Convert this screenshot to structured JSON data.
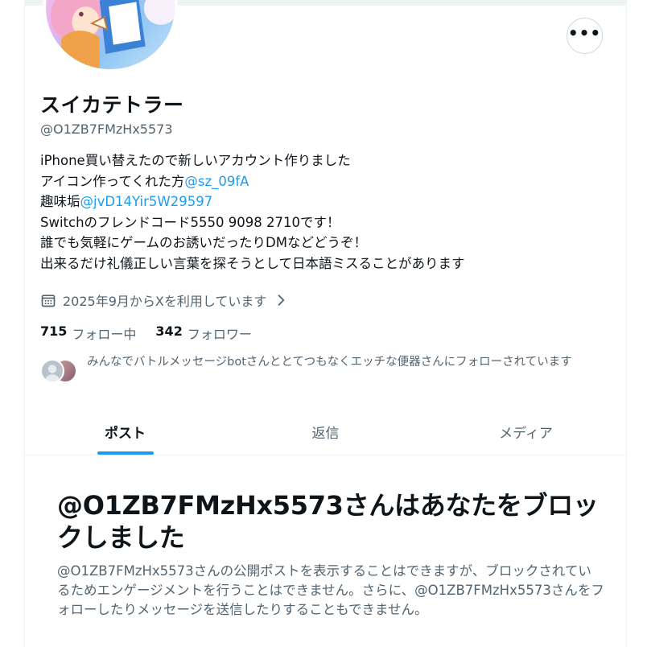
{
  "profile": {
    "display_name": "スイカテトラー",
    "handle": "@O1ZB7FMzHx5573",
    "bio": {
      "line1": "iPhone買い替えたので新しいアカウント作りました",
      "line2_text": "アイコン作ってくれた方",
      "line2_mention": "@sz_09fA",
      "line3_text": "趣味垢",
      "line3_mention": "@jvD14Yir5W29597",
      "line4": "Switchのフレンドコード5550 9098 2710です！",
      "line5": "誰でも気軽にゲームのお誘いだったりDMなどどうぞ！",
      "line6": "出来るだけ礼儀正しい言葉を探そうとして日本語ミスることがあります"
    },
    "joined": "2025年9月からXを利用しています",
    "following_count": "715",
    "following_label": "フォロー中",
    "followers_count": "342",
    "followers_label": "フォロワー",
    "followers_you_know": "みんなでバトルメッセージbotさんととてつもなくエッチな便器さんにフォローされています"
  },
  "tabs": [
    {
      "label": "ポスト",
      "active": true
    },
    {
      "label": "返信",
      "active": false
    },
    {
      "label": "メディア",
      "active": false
    }
  ],
  "blocked": {
    "title": "@O1ZB7FMzHx5573さんはあなたをブロックしました",
    "description": "@O1ZB7FMzHx5573さんの公開ポストを表示することはできますが、ブロックされているためエンゲージメントを行うことはできません。さらに、@O1ZB7FMzHx5573さんをフォローしたりメッセージを送信したりすることもできません。"
  },
  "icons": {
    "more": "more-horizontal-icon",
    "calendar": "calendar-icon",
    "chevron": "chevron-right-icon"
  },
  "colors": {
    "accent": "#1d9bf0",
    "text_primary": "#0f1419",
    "text_secondary": "#536471",
    "border": "#eff3f4"
  }
}
